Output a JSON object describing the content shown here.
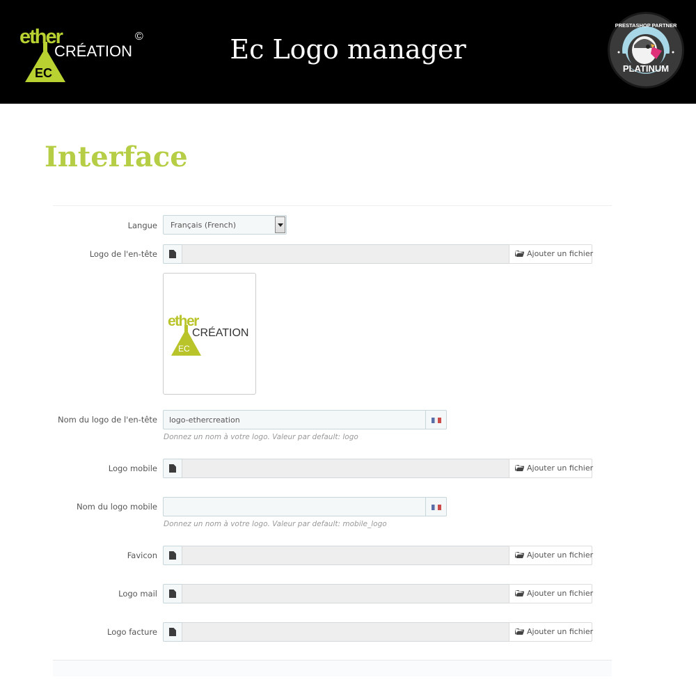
{
  "header": {
    "brand": {
      "word1": "ether",
      "word2": "CRÉATION",
      "mark": "EC",
      "copyright": "©"
    },
    "title": "Ec Logo manager",
    "partner_badge": {
      "top_text": "PRESTASHOP PARTNER",
      "bottom_text": "PLATINUM"
    }
  },
  "section": {
    "title": "Interface"
  },
  "colors": {
    "accent_green": "#b5ce45",
    "banner_bg": "#000000"
  },
  "form": {
    "language": {
      "label": "Langue",
      "selected": "Français (French)"
    },
    "header_logo": {
      "label": "Logo de l'en-tête",
      "button": "Ajouter un fichier",
      "preview": {
        "word1": "ether",
        "word2": "CRÉATION",
        "mark": "EC"
      }
    },
    "header_logo_name": {
      "label": "Nom du logo de l'en-tête",
      "value": "logo-ethercreation",
      "help": "Donnez un nom à votre logo. Valeur par default: logo"
    },
    "mobile_logo": {
      "label": "Logo mobile",
      "button": "Ajouter un fichier"
    },
    "mobile_logo_name": {
      "label": "Nom du logo mobile",
      "value": "",
      "help": "Donnez un nom à votre logo. Valeur par default: mobile_logo"
    },
    "favicon": {
      "label": "Favicon",
      "button": "Ajouter un fichier"
    },
    "mail_logo": {
      "label": "Logo mail",
      "button": "Ajouter un fichier"
    },
    "invoice_logo": {
      "label": "Logo facture",
      "button": "Ajouter un fichier"
    }
  }
}
